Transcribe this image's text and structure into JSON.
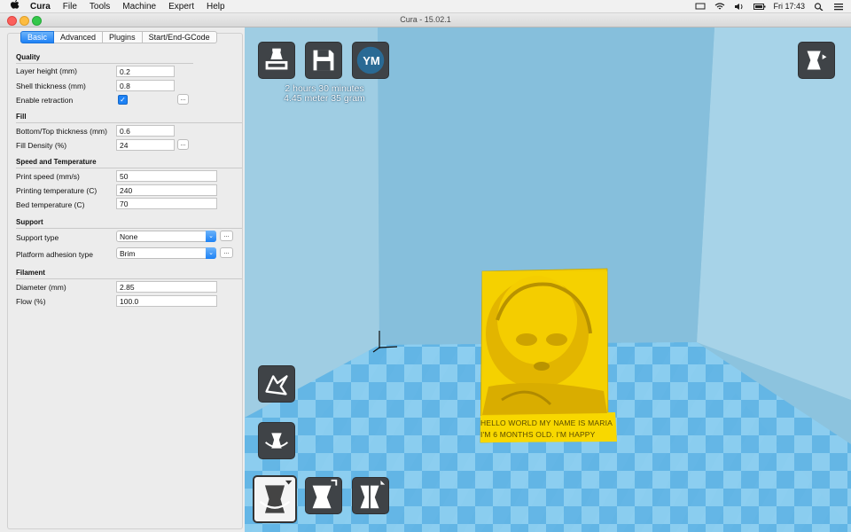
{
  "menubar": {
    "app_name": "Cura",
    "menus": [
      "File",
      "Tools",
      "Machine",
      "Expert",
      "Help"
    ],
    "clock": "Fri 17:43"
  },
  "window": {
    "title": "Cura - 15.02.1"
  },
  "tabs": [
    "Basic",
    "Advanced",
    "Plugins",
    "Start/End-GCode"
  ],
  "sections": {
    "quality": "Quality",
    "fill": "Fill",
    "speed": "Speed and Temperature",
    "support": "Support",
    "filament": "Filament"
  },
  "fields": {
    "layer_height": {
      "label": "Layer height (mm)",
      "value": "0.2"
    },
    "shell_thickness": {
      "label": "Shell thickness (mm)",
      "value": "0.8"
    },
    "enable_retraction": {
      "label": "Enable retraction",
      "checked": true
    },
    "bottom_top": {
      "label": "Bottom/Top thickness (mm)",
      "value": "0.6"
    },
    "fill_density": {
      "label": "Fill Density (%)",
      "value": "24"
    },
    "print_speed": {
      "label": "Print speed (mm/s)",
      "value": "50"
    },
    "print_temp": {
      "label": "Printing temperature (C)",
      "value": "240"
    },
    "bed_temp": {
      "label": "Bed temperature (C)",
      "value": "70"
    },
    "support_type": {
      "label": "Support type",
      "value": "None"
    },
    "adhesion": {
      "label": "Platform adhesion type",
      "value": "Brim"
    },
    "diameter": {
      "label": "Diameter (mm)",
      "value": "2.85"
    },
    "flow": {
      "label": "Flow (%)",
      "value": "100.0"
    }
  },
  "dots_label": "...",
  "viewport": {
    "estimate_time": "2 hours 30 minutes",
    "estimate_material": "4.45 meter 35 gram",
    "ym_label": "YM",
    "plate_line1": "HELLO WORLD MY NAME IS MARIA",
    "plate_line2": "I'M 6 MONTHS OLD. I'M HAPPY"
  },
  "colors": {
    "sky": "#8ec6e2",
    "floor_a": "#5fb3e4",
    "floor_b": "#8ccdf0",
    "model": "#f6d000",
    "accent": "#1e82f5"
  }
}
